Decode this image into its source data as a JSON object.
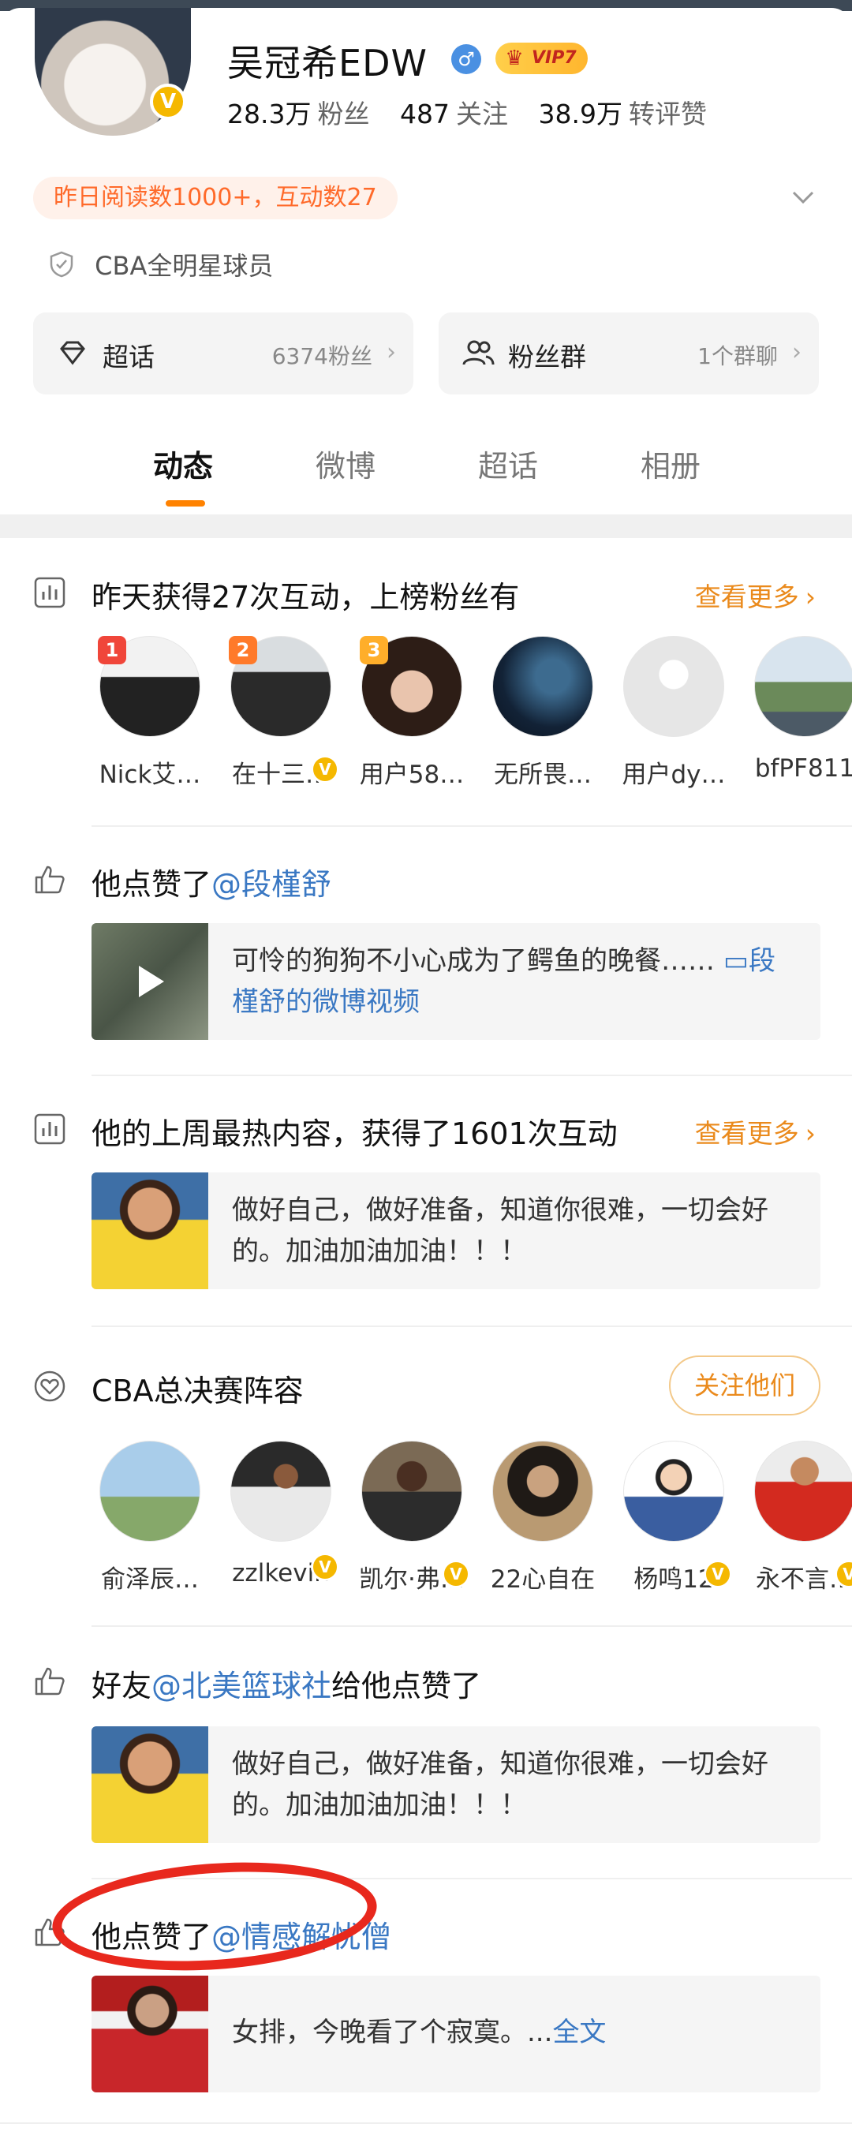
{
  "profile": {
    "name": "吴冠希EDW",
    "gender_icon": "male-icon",
    "verified_badge": "V",
    "vip_label": "VIP7",
    "stats": [
      {
        "num": "28.3万",
        "label": "粉丝"
      },
      {
        "num": "487",
        "label": "关注"
      },
      {
        "num": "38.9万",
        "label": "转评赞"
      }
    ],
    "reads_pill": "昨日阅读数1000+，互动数27",
    "cert": "CBA全明星球员",
    "supertopic": {
      "title": "超话",
      "meta": "6374粉丝"
    },
    "fangroup": {
      "title": "粉丝群",
      "meta": "1个群聊"
    }
  },
  "tabs": [
    {
      "label": "动态",
      "active": true
    },
    {
      "label": "微博",
      "active": false
    },
    {
      "label": "超话",
      "active": false
    },
    {
      "label": "相册",
      "active": false
    }
  ],
  "feed": {
    "interaction": {
      "title": "昨天获得27次互动，上榜粉丝有",
      "see_more": "查看更多",
      "users": [
        {
          "name": "Nick艾…",
          "rank": "1"
        },
        {
          "name": "在十三…",
          "rank": "2"
        },
        {
          "name": "用户58…",
          "rank": "3"
        },
        {
          "name": "无所畏…"
        },
        {
          "name": "用户dy…"
        },
        {
          "name": "bfPF811"
        }
      ]
    },
    "like1": {
      "prefix": "他点赞了",
      "mention": "@段槿舒",
      "text": "可怜的狗狗不小心成为了鳄鱼的晚餐……",
      "link": "段槿舒的微博视频"
    },
    "hot": {
      "title": "他的上周最热内容，获得了1601次互动",
      "see_more": "查看更多",
      "text": "做好自己，做好准备，知道你很难，一切会好的。加油加油加油！！！"
    },
    "cba": {
      "title": "CBA总决赛阵容",
      "follow_label": "关注他们",
      "users": [
        {
          "name": "俞泽辰…"
        },
        {
          "name": "zzlkevin"
        },
        {
          "name": "凯尔·弗…"
        },
        {
          "name": "22心自在"
        },
        {
          "name": "杨鸣12"
        },
        {
          "name": "永不言…"
        }
      ]
    },
    "friend_like": {
      "prefix": "好友",
      "mention": "@北美篮球社",
      "suffix": "给他点赞了",
      "text": "做好自己，做好准备，知道你很难，一切会好的。加油加油加油！！！"
    },
    "like2": {
      "prefix": "他点赞了",
      "mention": "@情感解忧僧",
      "text": "女排，今晚看了个寂寞。...",
      "link": "全文"
    }
  },
  "colors": {
    "accent": "#ff8200",
    "link": "#3a78c3",
    "annotation": "#e8281d"
  }
}
